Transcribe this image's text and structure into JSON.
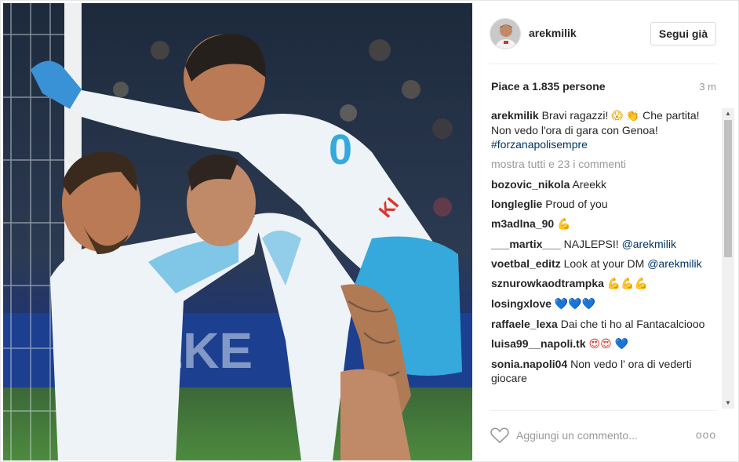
{
  "post": {
    "username": "arekmilik",
    "follow_label": "Segui già",
    "likes_text": "Piace a 1.835 persone",
    "time_ago": "3 m",
    "show_all_comments": "mostra tutti e 23 i commenti",
    "caption": {
      "user": "arekmilik",
      "text_a": "Bravi ragazzi!",
      "text_b": "Che partita! Non vedo l'ora di gara con Genoa!",
      "hashtag": "#forzanapolisempre"
    }
  },
  "comments": [
    {
      "user": "bozovic_nikola",
      "text": "Areekk"
    },
    {
      "user": "longleglie",
      "text": "Proud of you"
    },
    {
      "user": "m3adlna_90",
      "text": ""
    },
    {
      "user": "___martix___",
      "text": "NAJLEPSI!",
      "mention": "@arekmilik"
    },
    {
      "user": "voetbal_editz",
      "text": "Look at your DM",
      "mention": "@arekmilik"
    },
    {
      "user": "sznurowkaodtrampka",
      "text": ""
    },
    {
      "user": "losingxlove",
      "text": ""
    },
    {
      "user": "raffaele_lexa",
      "text": "Dai che ti ho al Fantacalciooo"
    },
    {
      "user": "luisa99__napoli.tk",
      "text": ""
    },
    {
      "user": "sonia.napoli04",
      "text": "Non vedo l' ora di vederti giocare"
    }
  ],
  "footer": {
    "comment_placeholder": "Aggiungi un commento...",
    "more_label": "ooo"
  },
  "icons": {
    "like": "heart-outline-icon",
    "more": "more-options-icon",
    "scroll_up": "scroll-up-arrow-icon",
    "scroll_down": "scroll-down-arrow-icon"
  },
  "colors": {
    "text": "#262626",
    "muted": "#999999",
    "link": "#003569",
    "divider": "#efefef",
    "napoli_kit": "#eef3f7",
    "napoli_blue": "#35a9dc"
  }
}
